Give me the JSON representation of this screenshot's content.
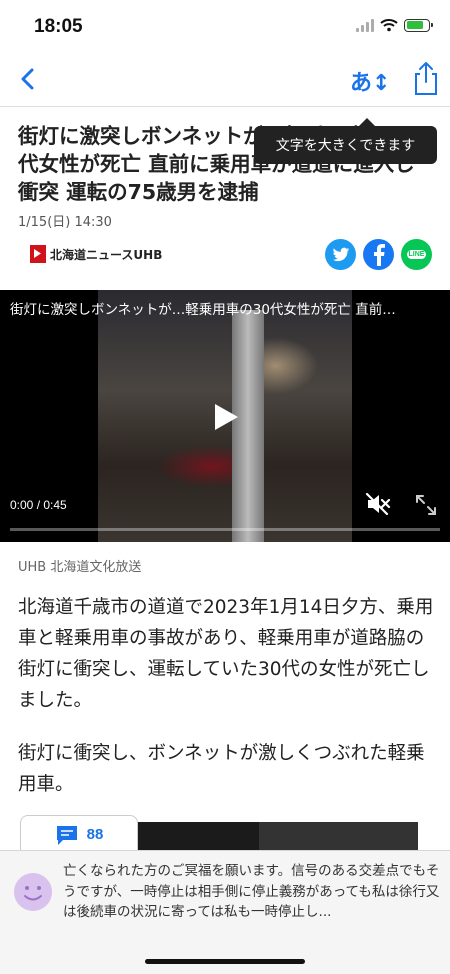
{
  "status_bar": {
    "time": "18:05",
    "battery_level": 0.8,
    "battery_color": "#2fbf3a"
  },
  "nav": {
    "font_size_label": "あ↕",
    "accent_color": "#1a73e8"
  },
  "tooltip": {
    "text": "文字を大きくできます"
  },
  "article": {
    "headline": "街灯に激突しボンネットが…軽乗用車の30代女性が死亡 直前に乗用車が道道に進入し衝突 運転の75歳男を逮捕",
    "date": "1/15(日) 14:30",
    "publisher": "北海道ニュースUHB",
    "source": "UHB 北海道文化放送",
    "paragraphs": [
      "北海道千歳市の道道で2023年1月14日夕方、乗用車と軽乗用車の事故があり、軽乗用車が道路脇の街灯に衝突し、運転していた30代の女性が死亡しました。",
      "街灯に衝突し、ボンネットが激しくつぶれた軽乗用車。"
    ]
  },
  "share": {
    "twitter_color": "#1d9bf0",
    "facebook_color": "#1877f2",
    "line_label": "LINE",
    "line_color": "#06c755"
  },
  "video": {
    "title": "街灯に激突しボンネットが…軽乗用車の30代女性が死亡 直前…",
    "time_display": "0:00 / 0:45",
    "progress": 0
  },
  "comments": {
    "count": "88",
    "preview": "亡くなられた方のご冥福を願います。信号のある交差点でもそうですが、一時停止は相手側に停止義務があっても私は徐行又は後続車の状況に寄っては私も一時停止し..."
  }
}
